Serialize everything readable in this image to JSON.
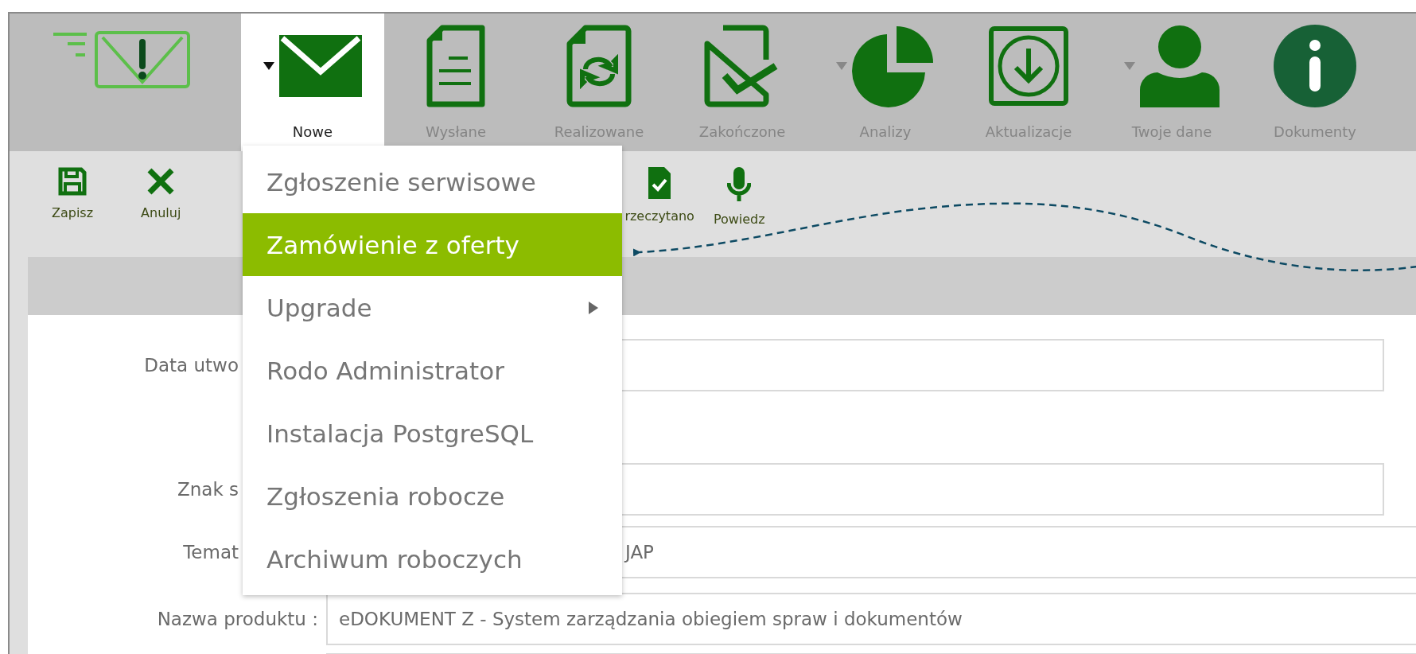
{
  "nav": {
    "items": [
      {
        "kind": "envelope",
        "label": "Nowe",
        "selected": true,
        "dropdown": true
      },
      {
        "kind": "document",
        "label": "Wysłane",
        "selected": false,
        "dropdown": false
      },
      {
        "kind": "refresh-doc",
        "label": "Realizowane",
        "selected": false,
        "dropdown": false
      },
      {
        "kind": "check-doc",
        "label": "Zakończone",
        "selected": false,
        "dropdown": false
      },
      {
        "kind": "pie",
        "label": "Analizy",
        "selected": false,
        "dropdown": true
      },
      {
        "kind": "download",
        "label": "Aktualizacje",
        "selected": false,
        "dropdown": false
      },
      {
        "kind": "user",
        "label": "Twoje dane",
        "selected": false,
        "dropdown": true
      },
      {
        "kind": "info",
        "label": "Dokumenty",
        "selected": false,
        "dropdown": false
      }
    ]
  },
  "toolbar": {
    "buttons": [
      {
        "kind": "save",
        "label": "Zapisz"
      },
      {
        "kind": "cancel",
        "label": "Anuluj"
      },
      {
        "kind": "read",
        "label": "rzeczytano"
      },
      {
        "kind": "mic",
        "label": "Powiedz"
      }
    ]
  },
  "menu": {
    "items": [
      {
        "label": "Zgłoszenie serwisowe",
        "selected": false,
        "submenu": false
      },
      {
        "label": "Zamówienie z oferty",
        "selected": true,
        "submenu": false
      },
      {
        "label": "Upgrade",
        "selected": false,
        "submenu": true
      },
      {
        "label": "Rodo Administrator",
        "selected": false,
        "submenu": false
      },
      {
        "label": "Instalacja PostgreSQL",
        "selected": false,
        "submenu": false
      },
      {
        "label": "Zgłoszenia robocze",
        "selected": false,
        "submenu": false
      },
      {
        "label": "Archiwum roboczych",
        "selected": false,
        "submenu": false
      }
    ]
  },
  "form": {
    "rows": [
      {
        "label": "Data utwo"
      },
      {
        "label": "Znak s"
      },
      {
        "label": "Temat",
        "value": "JAP"
      },
      {
        "label": "Nazwa produktu :",
        "value": "eDOKUMENT Z - System zarządzania obiegiem spraw i dokumentów"
      }
    ]
  }
}
